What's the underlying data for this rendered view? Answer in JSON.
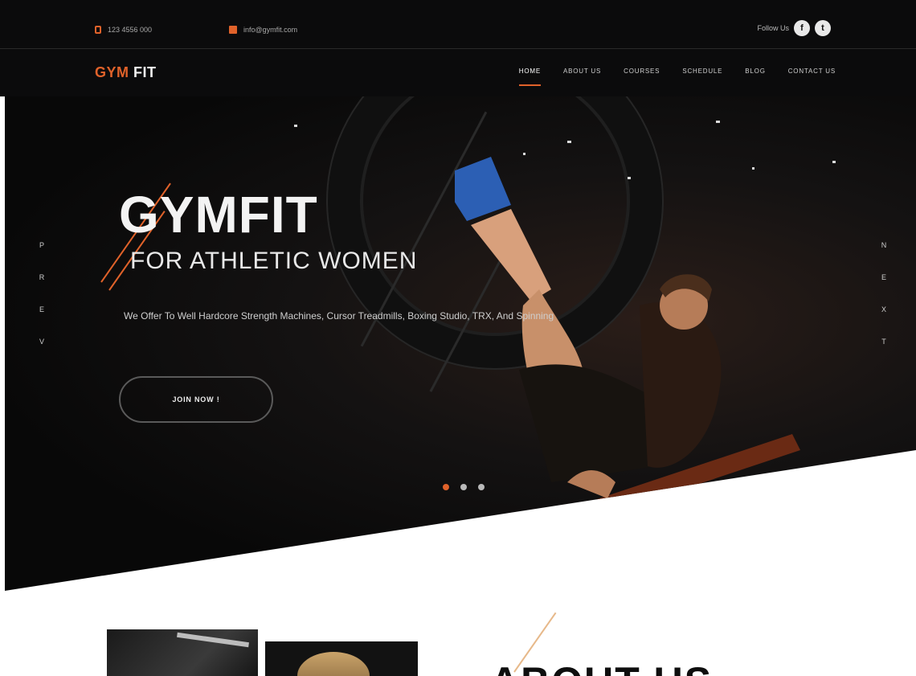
{
  "topbar": {
    "phone": "123 4556 000",
    "email": "info@gymfit.com",
    "follow_label": "Follow Us",
    "social": [
      {
        "icon": "facebook-icon",
        "glyph": "f"
      },
      {
        "icon": "twitter-icon",
        "glyph": "t"
      }
    ]
  },
  "nav": {
    "logo_gym": "GYM",
    "logo_fit": "FIT",
    "items": [
      {
        "label": "HOME",
        "active": true
      },
      {
        "label": "ABOUT US",
        "active": false
      },
      {
        "label": "COURSES",
        "active": false
      },
      {
        "label": "SCHEDULE",
        "active": false
      },
      {
        "label": "BLOG",
        "active": false
      },
      {
        "label": "CONTACT US",
        "active": false
      }
    ]
  },
  "hero": {
    "title": "GYMFIT",
    "subtitle": "FOR ATHLETIC WOMEN",
    "description": "We Offer To Well Hardcore Strength Machines, Cursor Treadmills, Boxing Studio, TRX, And Spinning",
    "button": "JOIN NOW !",
    "prev_letters": [
      "P",
      "R",
      "E",
      "V"
    ],
    "next_letters": [
      "N",
      "E",
      "X",
      "T"
    ],
    "dots": [
      true,
      false,
      false
    ]
  },
  "about": {
    "heading": "ABOUT US"
  },
  "colors": {
    "accent": "#e0622a",
    "dark": "#0b0b0c",
    "text_light": "#f3f3f3"
  }
}
